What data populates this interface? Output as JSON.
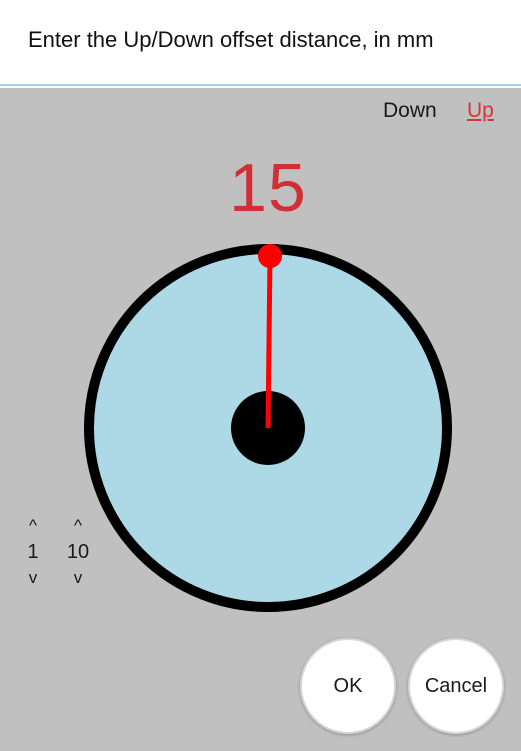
{
  "window": {
    "title": "Enter the Up/Down offset distance, in mm"
  },
  "direction": {
    "down_label": "Down",
    "up_label": "Up",
    "selected": "Up"
  },
  "dial": {
    "value": "15",
    "face_color": "#add8e6",
    "rim_color": "#000000",
    "hub_color": "#000000",
    "needle_color": "#ff0000",
    "readout_color": "#d12f35"
  },
  "steppers": [
    {
      "up_symbol": "^",
      "label": "1",
      "down_symbol": "v"
    },
    {
      "up_symbol": "^",
      "label": "10",
      "down_symbol": "v"
    }
  ],
  "buttons": {
    "ok_label": "OK",
    "cancel_label": "Cancel"
  }
}
